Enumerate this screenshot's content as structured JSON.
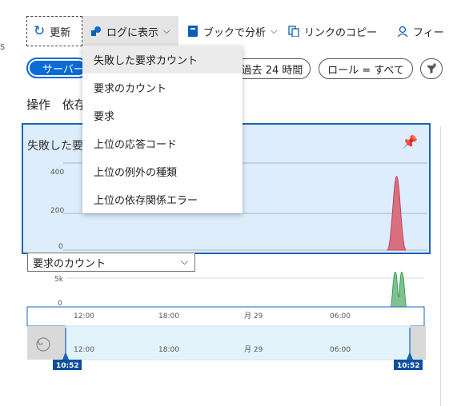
{
  "toolbar": {
    "refresh_label": "更新",
    "log_label": "ログに表示",
    "workbook_label": "ブックで分析",
    "copy_label": "リンクのコピー",
    "feedback_label": "フィー"
  },
  "filters": {
    "server_label": "サーバー",
    "time_label": "過去 24 時間",
    "role_label": "ロール = すべて"
  },
  "tabs": [
    "操作",
    "依存"
  ],
  "chart": {
    "title": "失敗した要"
  },
  "menu": {
    "items": [
      "失敗した要求カウント",
      "要求のカウント",
      "要求",
      "上位の応答コード",
      "上位の例外の種類",
      "上位の依存関係エラー"
    ]
  },
  "select": {
    "value": "要求のカウント"
  },
  "brush": {
    "ticks": [
      "12:00",
      "18:00",
      "月 29",
      "06:00"
    ],
    "start_badge": "10:52",
    "end_badge": "10:52"
  },
  "colors": {
    "accent": "#0a6ad6",
    "failed": "#d9707e",
    "requests": "#3a9d5a"
  },
  "chart_data": [
    {
      "type": "area",
      "series": [
        {
          "values": [
            0,
            0,
            0,
            0,
            0,
            0,
            0,
            0,
            0,
            340,
            0,
            0
          ]
        }
      ],
      "ylim": [
        0,
        500
      ],
      "yticks": [
        "400",
        "200",
        "0"
      ]
    },
    {
      "type": "area",
      "series": [
        {
          "values": [
            0,
            0,
            0,
            0,
            0,
            0,
            0,
            0,
            0,
            7000,
            7000,
            0
          ]
        }
      ],
      "yticks": [
        "5k",
        "0"
      ],
      "xticks": [
        "12:00",
        "18:00",
        "月 29",
        "06:00"
      ]
    }
  ]
}
